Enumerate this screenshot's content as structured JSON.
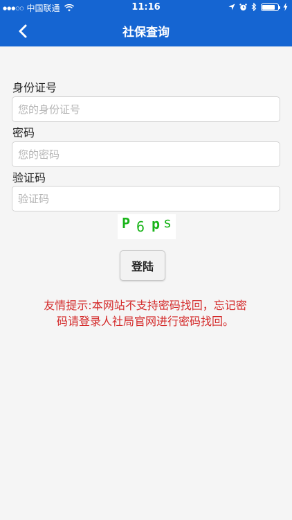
{
  "status_bar": {
    "signal_dots": "●●●○○",
    "carrier": "中国联通",
    "time": "11:16",
    "battery_level": 0.8,
    "icons": [
      "wifi-icon",
      "location-icon",
      "alarm-icon",
      "bluetooth-icon",
      "battery-icon",
      "charging-icon"
    ]
  },
  "header": {
    "title": "社保查询",
    "background_color": "#1565d2"
  },
  "form": {
    "id_label": "身份证号",
    "id_placeholder": "您的身份证号",
    "password_label": "密码",
    "password_placeholder": "您的密码",
    "captcha_label": "验证码",
    "captcha_placeholder": "验证码",
    "captcha_chars": [
      "P",
      "6",
      "p",
      "s"
    ],
    "captcha_color": "#19b419",
    "login_label": "登陆"
  },
  "notice": {
    "line1": "友情提示:本网站不支持密码找回，忘记密",
    "line2": "码请登录人社局官网进行密码找回。",
    "color": "#d42a2a"
  }
}
